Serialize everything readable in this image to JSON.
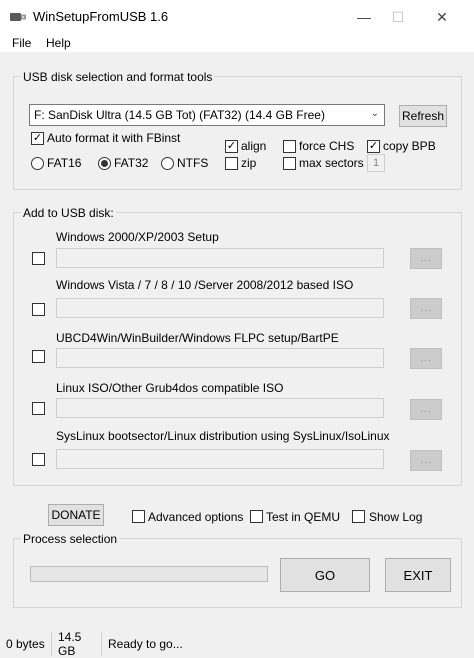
{
  "window": {
    "title": "WinSetupFromUSB 1.6",
    "caption_minimize": "—",
    "caption_maximize": "☐",
    "caption_close": "✕"
  },
  "menu": {
    "file": "File",
    "help": "Help"
  },
  "usb_group": {
    "label": "USB disk selection and format tools",
    "disk_value": "F: SanDisk Ultra (14.5 GB Tot) (FAT32) (14.4 GB Free)",
    "refresh": "Refresh",
    "auto_format": {
      "label": "Auto format it with FBinst",
      "checked": true
    },
    "align": {
      "label": "align",
      "checked": true
    },
    "force_chs": {
      "label": "force CHS",
      "checked": false
    },
    "copy_bpb": {
      "label": "copy BPB",
      "checked": true
    },
    "zip": {
      "label": "zip",
      "checked": false
    },
    "max_sectors": {
      "label": "max sectors",
      "checked": false
    },
    "max_sectors_value": "1",
    "fs_options": [
      {
        "label": "FAT16",
        "selected": false
      },
      {
        "label": "FAT32",
        "selected": true
      },
      {
        "label": "NTFS",
        "selected": false
      }
    ]
  },
  "add_group": {
    "label": "Add to USB disk:",
    "browse_label": "...",
    "items": [
      {
        "label": "Windows 2000/XP/2003 Setup",
        "checked": false,
        "path": ""
      },
      {
        "label": "Windows Vista / 7 / 8 / 10 /Server 2008/2012 based ISO",
        "checked": false,
        "path": ""
      },
      {
        "label": "UBCD4Win/WinBuilder/Windows FLPC setup/BartPE",
        "checked": false,
        "path": ""
      },
      {
        "label": "Linux ISO/Other Grub4dos compatible ISO",
        "checked": false,
        "path": ""
      },
      {
        "label": "SysLinux bootsector/Linux distribution using SysLinux/IsoLinux",
        "checked": false,
        "path": ""
      }
    ]
  },
  "options": {
    "donate": "DONATE",
    "advanced": {
      "label": "Advanced options",
      "checked": false
    },
    "qemu": {
      "label": "Test in QEMU",
      "checked": false
    },
    "show_log": {
      "label": "Show Log",
      "checked": false
    }
  },
  "process": {
    "label": "Process selection",
    "progress": 0,
    "go": "GO",
    "exit": "EXIT"
  },
  "status": {
    "size": "0 bytes",
    "total": "14.5 GB",
    "message": "Ready to go..."
  },
  "colors": {
    "accent": "#0078d7",
    "window_bg": "#f0f0f0"
  }
}
